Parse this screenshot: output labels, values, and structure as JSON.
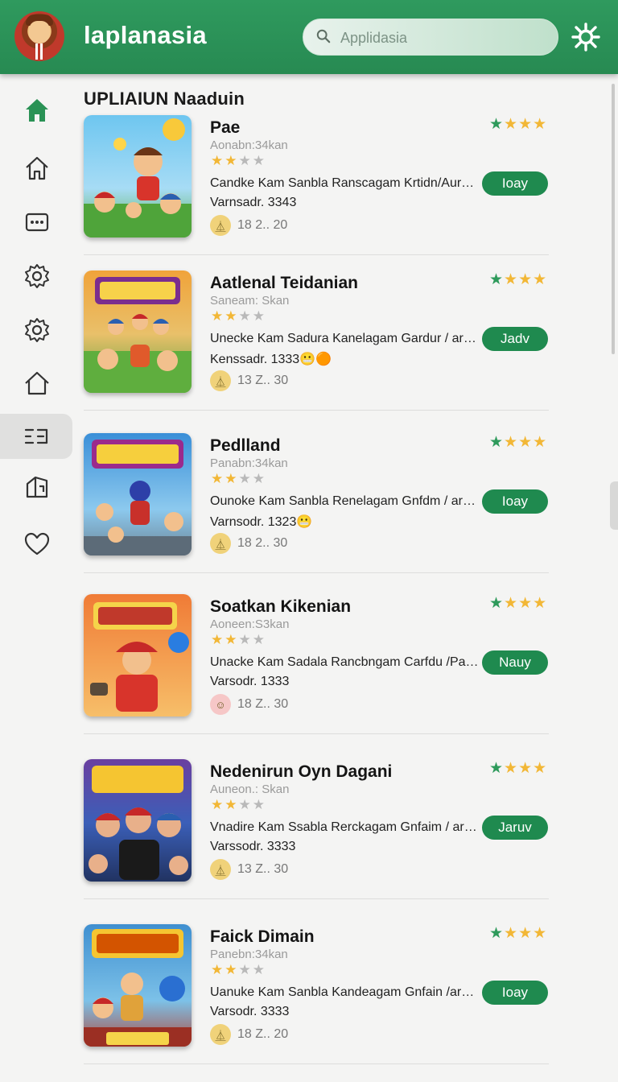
{
  "app": {
    "title": "laplanasia"
  },
  "search": {
    "placeholder": "Applidasia"
  },
  "section_title": "UPLIAIUN Naaduin",
  "sidebar": {
    "items": [
      {
        "icon": "home-filled-icon"
      },
      {
        "icon": "home-icon"
      },
      {
        "icon": "chat-icon"
      },
      {
        "icon": "gear-icon"
      },
      {
        "icon": "gear-icon"
      },
      {
        "icon": "house-icon"
      },
      {
        "icon": "list-icon",
        "active": true
      },
      {
        "icon": "map-icon"
      },
      {
        "icon": "heart-icon"
      }
    ]
  },
  "apps": [
    {
      "name": "Pae",
      "subtitle": "Aonabn:34kan",
      "description": "Candke Kam Sanbla Ranscagam Krtidn/Aurdar...",
      "version": "Varnsadr. 3343",
      "version_emoji": "",
      "downloads": "18 2.. 20",
      "button": "Ioay",
      "rating": 2
    },
    {
      "name": "Aatlenal Teidanian",
      "subtitle": "Saneam: Skan",
      "description": "Unecke Kam Sadura Kanelagam Gardur / ardar...",
      "version": "Kenssadr. 1333",
      "version_emoji": "😬🟠",
      "downloads": "13 Z.. 30",
      "button": "Jadv",
      "rating": 2
    },
    {
      "name": "Pedlland",
      "subtitle": "Panabn:34kan",
      "description": "Ounoke Kam Sanbla Renelagam Gnfdm / ardar...",
      "version": "Varnsodr. 1323",
      "version_emoji": "😬",
      "downloads": "18 2.. 30",
      "button": "Ioay",
      "rating": 2
    },
    {
      "name": "Soatkan Kikenian",
      "subtitle": "Aoneen:S3kan",
      "description": "Unacke Kam Sadala Rancbngam Carfdu /Patdek...",
      "version": "Varsodr. 1333",
      "version_emoji": "",
      "downloads": "18 Z.. 30",
      "button": "Nauy",
      "rating": 2
    },
    {
      "name": "Nedenirun Oyn Dagani",
      "subtitle": "Auneon.: Skan",
      "description": "Vnadire Kam Ssabla Rerckagam Gnfaim / ardar...",
      "version": "Varssodr. 3333",
      "version_emoji": "",
      "downloads": "13 Z.. 30",
      "button": "Jaruv",
      "rating": 2
    },
    {
      "name": "Faick Dimain",
      "subtitle": "Panebn:34kan",
      "description": "Uanuke Kam Sanbla Kandeagam Gnfain /ardak...",
      "version": "Varsodr. 3333",
      "version_emoji": "",
      "downloads": "18 Z.. 20",
      "button": "Ioay",
      "rating": 2
    }
  ],
  "colors": {
    "header": "#2f9a5e",
    "button": "#1f8a4f",
    "star_green": "#2e9a5b",
    "star_yellow": "#f2b736"
  }
}
